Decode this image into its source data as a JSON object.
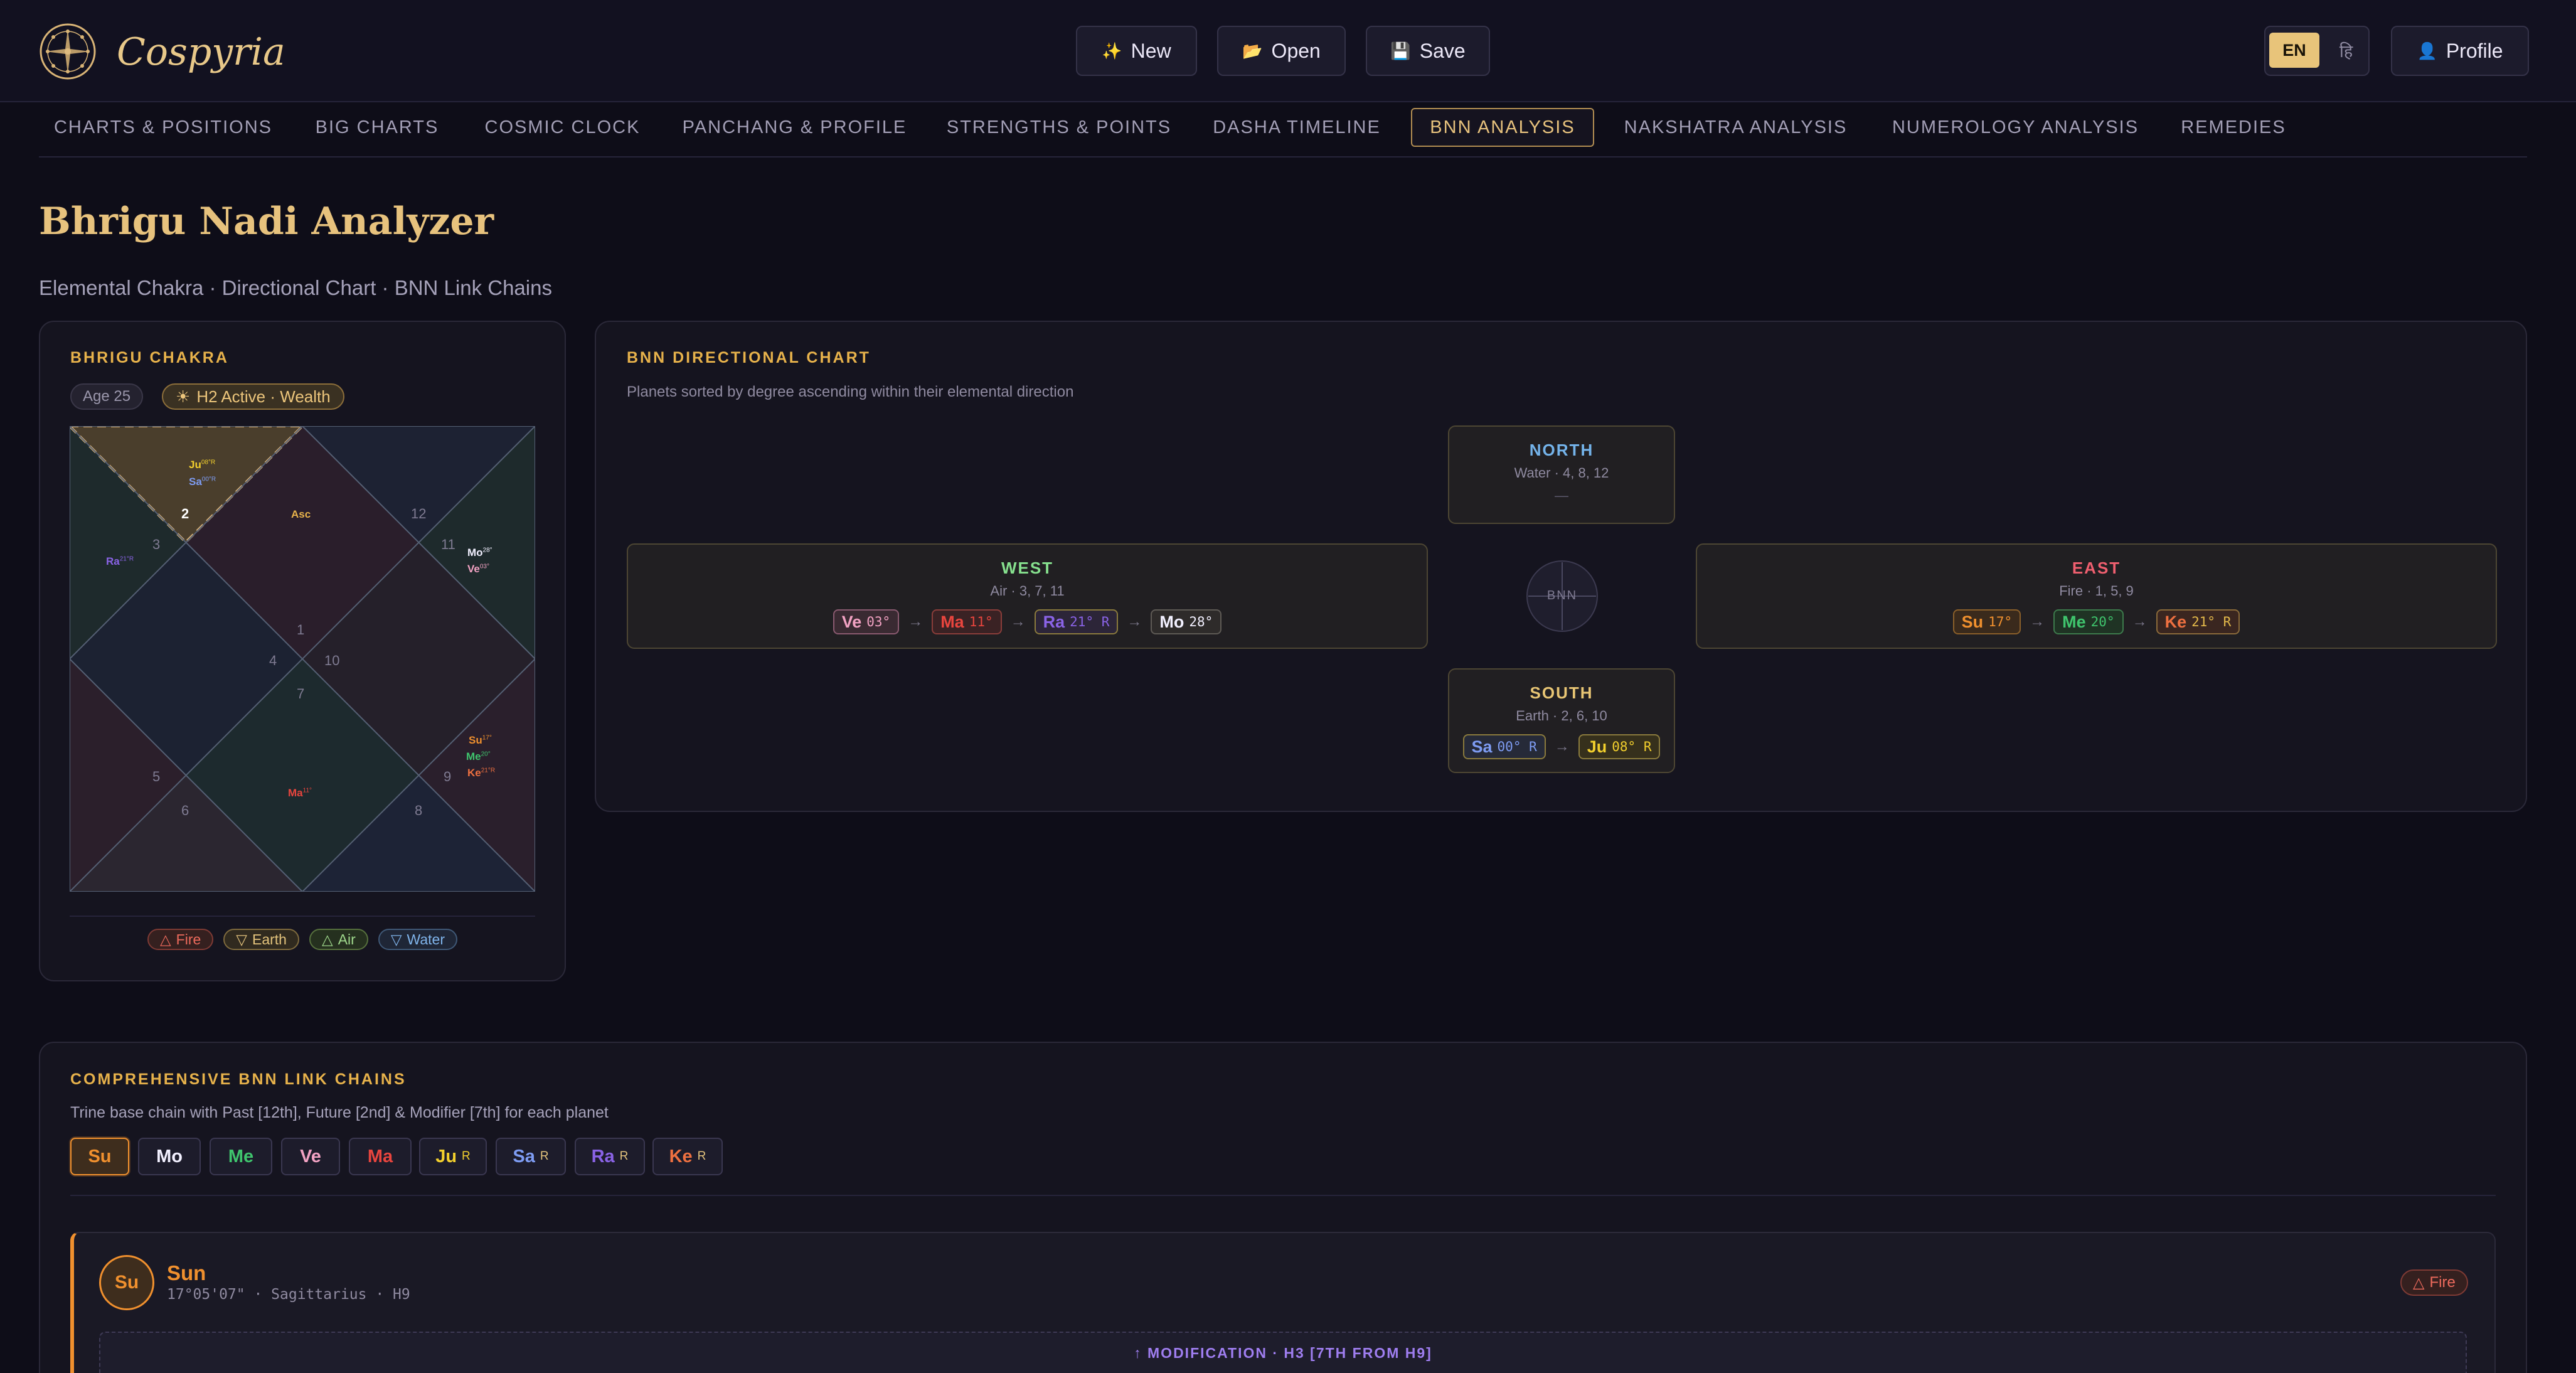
{
  "app": {
    "name": "Cospyria",
    "logo_icon": "compass-wheel-icon"
  },
  "toolbar": {
    "new_label": "New",
    "open_label": "Open",
    "save_label": "Save",
    "new_icon": "✨",
    "open_icon": "📂",
    "save_icon": "💾"
  },
  "language": {
    "en_label": "EN",
    "hi_label": "हि"
  },
  "profile": {
    "label": "Profile",
    "icon": "👤"
  },
  "tabs": [
    {
      "label": "CHARTS & POSITIONS"
    },
    {
      "label": "BIG CHARTS"
    },
    {
      "label": "COSMIC CLOCK"
    },
    {
      "label": "PANCHANG & PROFILE"
    },
    {
      "label": "STRENGTHS & POINTS"
    },
    {
      "label": "DASHA TIMELINE"
    },
    {
      "label": "BNN ANALYSIS",
      "active": true
    },
    {
      "label": "NAKSHATRA ANALYSIS"
    },
    {
      "label": "NUMEROLOGY ANALYSIS"
    },
    {
      "label": "REMEDIES"
    }
  ],
  "page": {
    "title": "Bhrigu Nadi Analyzer",
    "subtitle": "Elemental Chakra · Directional Chart · BNN Link Chains"
  },
  "chakra": {
    "heading": "BHRIGU CHAKRA",
    "age_badge": "Age 25",
    "active_badge": "H2 Active · Wealth",
    "house_numbers": [
      "1",
      "2",
      "3",
      "4",
      "5",
      "6",
      "7",
      "8",
      "9",
      "10",
      "11",
      "12"
    ],
    "asc_label": "Asc",
    "planets": {
      "ju": {
        "name": "Ju",
        "deg": "08°R"
      },
      "sa": {
        "name": "Sa",
        "deg": "00°R"
      },
      "ra": {
        "name": "Ra",
        "deg": "21°R"
      },
      "mo": {
        "name": "Mo",
        "deg": "28°"
      },
      "ve": {
        "name": "Ve",
        "deg": "03°"
      },
      "su": {
        "name": "Su",
        "deg": "17°"
      },
      "me": {
        "name": "Me",
        "deg": "20°"
      },
      "ke": {
        "name": "Ke",
        "deg": "21°R"
      },
      "ma": {
        "name": "Ma",
        "deg": "11°"
      }
    },
    "legend": [
      {
        "symbol": "△",
        "label": "Fire"
      },
      {
        "symbol": "▽",
        "label": "Earth"
      },
      {
        "symbol": "△",
        "label": "Air"
      },
      {
        "symbol": "▽",
        "label": "Water"
      }
    ]
  },
  "directional": {
    "heading": "BNN DIRECTIONAL CHART",
    "subtitle": "Planets sorted by degree ascending within their elemental direction",
    "center_label": "BNN",
    "north": {
      "title": "NORTH",
      "sub": "Water · 4, 8, 12",
      "empty": "—"
    },
    "west": {
      "title": "WEST",
      "sub": "Air · 3, 7, 11",
      "planets": [
        {
          "name": "Ve",
          "deg": "03°"
        },
        {
          "name": "Ma",
          "deg": "11°"
        },
        {
          "name": "Ra",
          "deg": "21° R"
        },
        {
          "name": "Mo",
          "deg": "28°"
        }
      ]
    },
    "east": {
      "title": "EAST",
      "sub": "Fire · 1, 5, 9",
      "planets": [
        {
          "name": "Su",
          "deg": "17°"
        },
        {
          "name": "Me",
          "deg": "20°"
        },
        {
          "name": "Ke",
          "deg": "21° R"
        }
      ]
    },
    "south": {
      "title": "SOUTH",
      "sub": "Earth · 2, 6, 10",
      "planets": [
        {
          "name": "Sa",
          "deg": "00° R"
        },
        {
          "name": "Ju",
          "deg": "08° R"
        }
      ]
    }
  },
  "chains": {
    "heading": "COMPREHENSIVE BNN LINK CHAINS",
    "subtitle": "Trine base chain with Past [12th], Future [2nd] & Modifier [7th] for each planet",
    "selectors": [
      {
        "name": "Su",
        "r": ""
      },
      {
        "name": "Mo",
        "r": ""
      },
      {
        "name": "Me",
        "r": ""
      },
      {
        "name": "Ve",
        "r": ""
      },
      {
        "name": "Ma",
        "r": ""
      },
      {
        "name": "Ju",
        "r": "R"
      },
      {
        "name": "Sa",
        "r": "R"
      },
      {
        "name": "Ra",
        "r": "R"
      },
      {
        "name": "Ke",
        "r": "R"
      }
    ],
    "detail": {
      "avatar": "Su",
      "name": "Sun",
      "position": "17°05'07\" · Sagittarius · H9",
      "element_symbol": "△",
      "element": "Fire",
      "modification": "↑ MODIFICATION · H3 [7TH FROM H9]"
    }
  },
  "colors": {
    "accent": "#e7b24b",
    "su": "#f0902e",
    "mo": "#f2f0ff",
    "me": "#3fc46d",
    "ve": "#f2a2c3",
    "ma": "#e8453e",
    "ju": "#f2cf2d",
    "sa": "#7e9cf2",
    "ra": "#8a63e6",
    "ke": "#ee7040",
    "west": "#86e08e",
    "north": "#74b3ea",
    "east": "#ef5f6f",
    "south": "#e8c574"
  }
}
